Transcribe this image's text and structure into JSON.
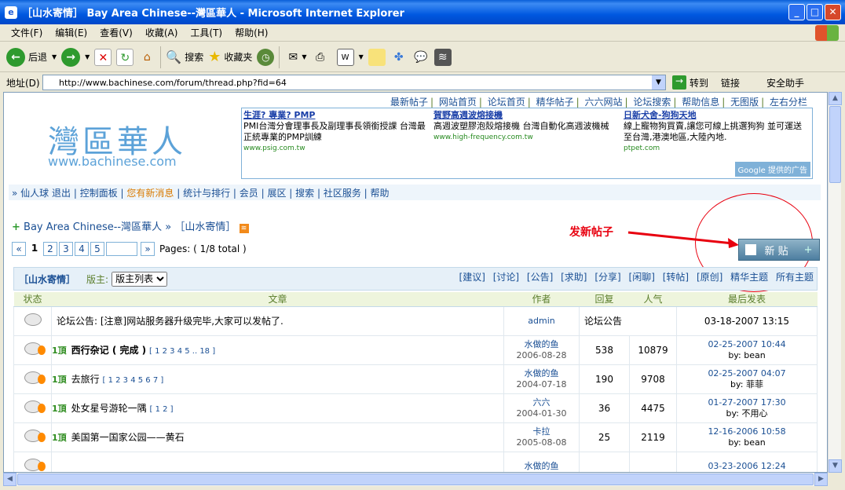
{
  "window": {
    "title": "［山水寄情］ Bay Area Chinese--灣區華人 - Microsoft Internet Explorer"
  },
  "menu": [
    "文件(F)",
    "编辑(E)",
    "查看(V)",
    "收藏(A)",
    "工具(T)",
    "帮助(H)"
  ],
  "toolbar": {
    "back": "后退",
    "search": "搜索",
    "favorites": "收藏夹"
  },
  "address": {
    "label": "地址(D)",
    "url": "http://www.bachinese.com/forum/thread.php?fid=64",
    "go": "转到",
    "links": "链接",
    "helper": "安全助手"
  },
  "toplinks": [
    "最新帖子",
    "网站首页",
    "论坛首页",
    "精华帖子",
    "六六网站",
    "论坛搜索",
    "帮助信息",
    "无图版",
    "左右分栏"
  ],
  "logo": {
    "cn": "灣區華人",
    "url": "www.bachinese.com"
  },
  "ads": [
    {
      "title": "生涯? 專業? PMP",
      "body": "PMI台灣分會理事長及副理事長領銜授課 台灣最正統專業的PMP訓練",
      "url": "www.psig.com.tw"
    },
    {
      "title": "賀野高週波熔接機",
      "body": "高週波塑膠泡殼熔接機 台灣自動化高週波機械",
      "url": "www.high-frequency.com.tw"
    },
    {
      "title": "日新犬舍-狗狗天地",
      "body": "線上寵物狗買賣,讓您可線上挑選狗狗 並可運送至台灣,港澳地區,大陸內地.",
      "url": "ptpet.com"
    }
  ],
  "google": "Google 提供的广告",
  "nav": {
    "user": "» 仙人球",
    "logout": "退出",
    "cp": "控制面板",
    "newmsg": "您有新消息",
    "stats": "统计与排行",
    "members": "会员",
    "exhibit": "展区",
    "search": "搜索",
    "community": "社区服务",
    "help": "帮助"
  },
  "breadcrumb": {
    "site": "Bay Area Chinese--灣區華人",
    "sep": "»",
    "forum": "［山水寄情］"
  },
  "pager": {
    "first": "«",
    "pages": [
      "1",
      "2",
      "3",
      "4",
      "5"
    ],
    "last": "»",
    "info": "Pages: ( 1/8 total )"
  },
  "annotation": "发新帖子",
  "newpost": "新 贴",
  "forumbar": {
    "name": "［山水寄情］",
    "mod_label": "版主:",
    "mod_select": "版主列表",
    "cats": [
      "[建议]",
      "[讨论]",
      "[公告]",
      "[求助]",
      "[分享]",
      "[闲聊]",
      "[转帖]",
      "[原创]",
      "精华主题",
      "所有主题"
    ]
  },
  "table": {
    "headers": [
      "状态",
      "文章",
      "作者",
      "回复",
      "人气",
      "最后发表"
    ],
    "rows": [
      {
        "title": "论坛公告: [注意]网站服务器升级完毕,大家可以发帖了.",
        "author": "admin",
        "date": "",
        "replies": "论坛公告",
        "views": "",
        "last": "03-18-2007 13:15",
        "by": ""
      },
      {
        "title": "西行杂记 ( 完成 )",
        "pages": "[ 1 2 3 4 5 .. 18 ]",
        "author": "水做的鱼",
        "date": "2006-08-28",
        "replies": "538",
        "views": "10879",
        "last": "02-25-2007 10:44",
        "by": "by: bean"
      },
      {
        "title": "去旅行",
        "pages": "[ 1 2 3 4 5 6 7 ]",
        "author": "水做的鱼",
        "date": "2004-07-18",
        "replies": "190",
        "views": "9708",
        "last": "02-25-2007 04:07",
        "by": "by: 菲菲"
      },
      {
        "title": "处女星号游轮一隅",
        "pages": "[ 1 2 ]",
        "author": "六六",
        "date": "2004-01-30",
        "replies": "36",
        "views": "4475",
        "last": "01-27-2007 17:30",
        "by": "by: 不用心"
      },
      {
        "title": "美国第一国家公园——黄石",
        "pages": "",
        "author": "卡拉",
        "date": "2005-08-08",
        "replies": "25",
        "views": "2119",
        "last": "12-16-2006 10:58",
        "by": "by: bean"
      },
      {
        "title": "",
        "pages": "",
        "author": "水做的鱼",
        "date": "",
        "replies": "",
        "views": "",
        "last": "03-23-2006 12:24",
        "by": ""
      }
    ]
  },
  "top_badge": "1頂"
}
